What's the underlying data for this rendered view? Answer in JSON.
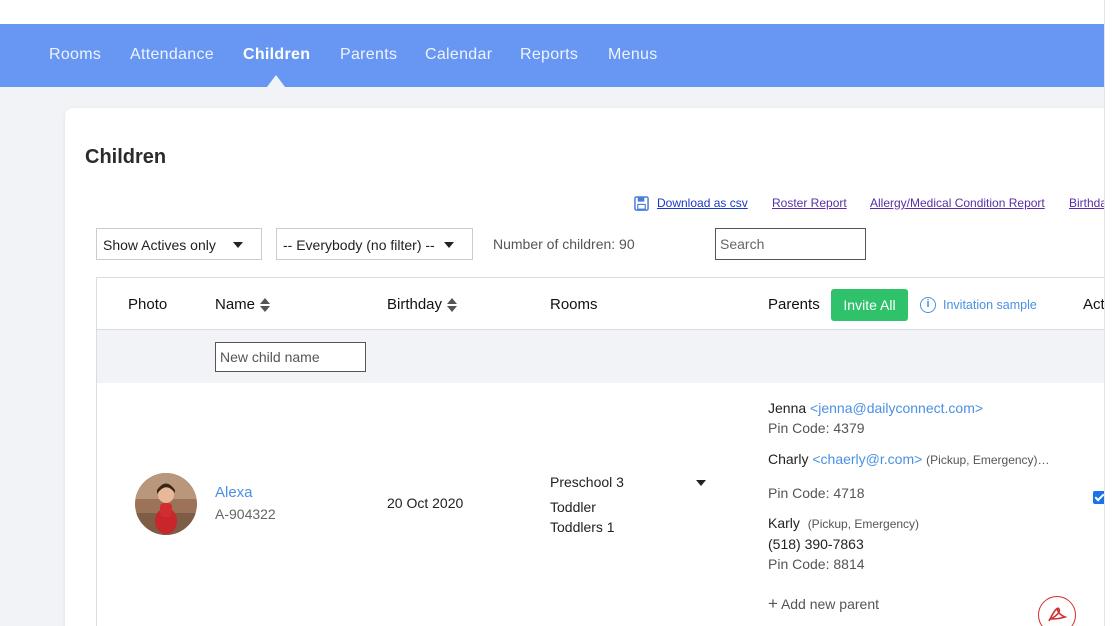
{
  "nav": {
    "items": [
      {
        "label": "Rooms"
      },
      {
        "label": "Attendance"
      },
      {
        "label": "Children"
      },
      {
        "label": "Parents"
      },
      {
        "label": "Calendar"
      },
      {
        "label": "Reports"
      },
      {
        "label": "Menus"
      }
    ],
    "active": "Children"
  },
  "page": {
    "title": "Children"
  },
  "links": {
    "download_csv": "Download as csv",
    "roster_report": "Roster Report",
    "allergy_report": "Allergy/Medical Condition Report",
    "birthday": "Birthda"
  },
  "filters": {
    "status": "Show Actives only",
    "group": "-- Everybody (no filter) --",
    "count_text": "Number of children: 90",
    "search_placeholder": "Search"
  },
  "table": {
    "headers": {
      "photo": "Photo",
      "name": "Name",
      "birthday": "Birthday",
      "rooms": "Rooms",
      "parents": "Parents",
      "active": "Act"
    },
    "invite_all": "Invite All",
    "invitation_sample": "Invitation sample",
    "new_child_placeholder": "New child name",
    "rows": [
      {
        "name": "Alexa",
        "id": "A-904322",
        "birthday": "20 Oct 2020",
        "room_selected": "Preschool 3",
        "rooms": [
          "Toddler",
          "Toddlers 1"
        ],
        "parents": [
          {
            "name": "Jenna",
            "email": "<jenna@dailyconnect.com>",
            "role": "",
            "phone": "",
            "pin": "Pin Code: 4379"
          },
          {
            "name": "Charly",
            "email": "<chaerly@r.com>",
            "role": "(Pickup, Emergency)…",
            "phone": "",
            "pin": "Pin Code: 4718"
          },
          {
            "name": "Karly",
            "email": "",
            "role": "(Pickup, Emergency)",
            "phone": "(518) 390-7863",
            "pin": "Pin Code: 8814"
          }
        ],
        "add_parent": "Add new parent",
        "active": true
      }
    ]
  },
  "colors": {
    "navbar": "#6797f2",
    "accent_green": "#2fc26b",
    "link_blue": "#4a90e2"
  }
}
